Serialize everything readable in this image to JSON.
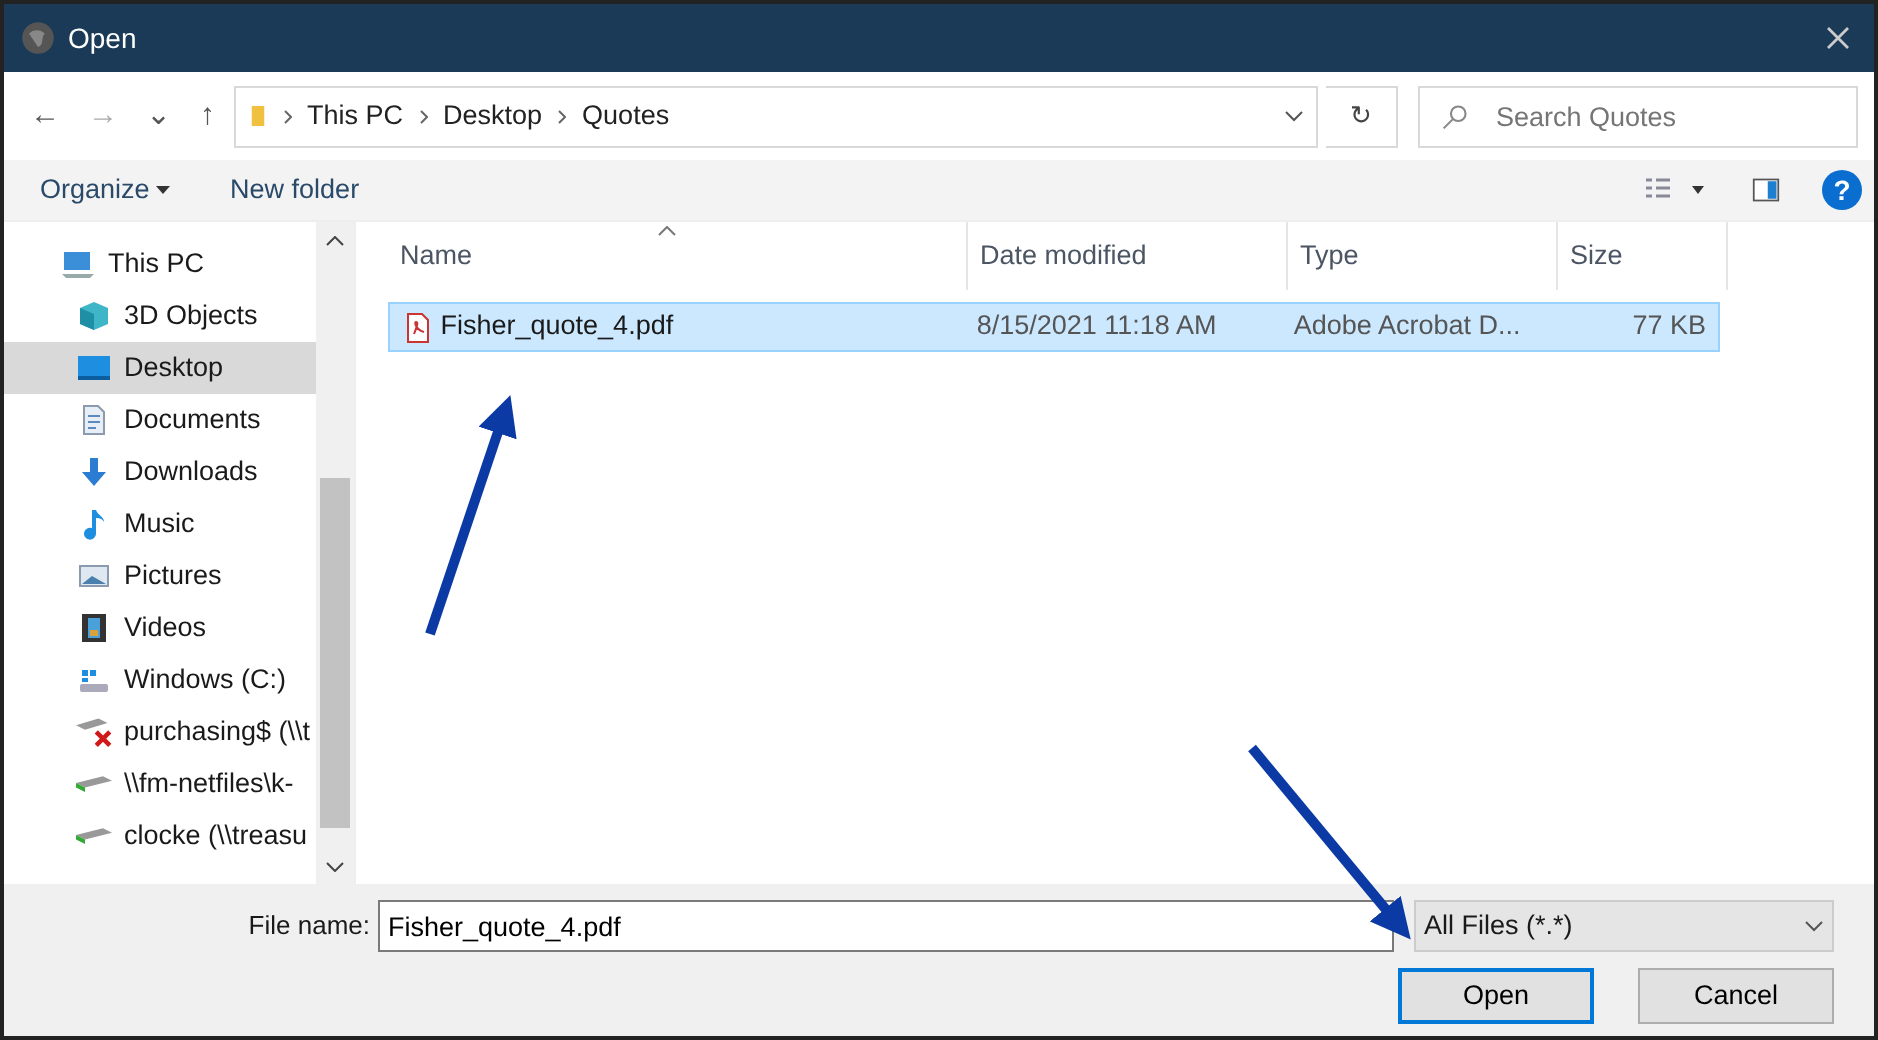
{
  "window": {
    "title": "Open"
  },
  "address": {
    "back": "←",
    "forward": "→",
    "recent": "⌄",
    "up": "↑",
    "path": [
      "This PC",
      "Desktop",
      "Quotes"
    ],
    "refresh": "↻"
  },
  "search": {
    "placeholder": "Search Quotes"
  },
  "toolbar": {
    "organize": "Organize",
    "new_folder": "New folder",
    "help": "?"
  },
  "sidebar": {
    "items": [
      {
        "label": "This PC",
        "kind": "pc",
        "selected": false
      },
      {
        "label": "3D Objects",
        "kind": "cube",
        "selected": false
      },
      {
        "label": "Desktop",
        "kind": "desktop",
        "selected": true
      },
      {
        "label": "Documents",
        "kind": "document",
        "selected": false
      },
      {
        "label": "Downloads",
        "kind": "download",
        "selected": false
      },
      {
        "label": "Music",
        "kind": "music",
        "selected": false
      },
      {
        "label": "Pictures",
        "kind": "pictures",
        "selected": false
      },
      {
        "label": "Videos",
        "kind": "videos",
        "selected": false
      },
      {
        "label": "Windows (C:)",
        "kind": "drive",
        "selected": false
      },
      {
        "label": "purchasing$ (\\\\t",
        "kind": "network_error",
        "selected": false
      },
      {
        "label": "\\\\fm-netfiles\\k-",
        "kind": "network",
        "selected": false
      },
      {
        "label": "clocke (\\\\treasu",
        "kind": "network",
        "selected": false
      }
    ]
  },
  "table": {
    "columns": [
      {
        "label": "Name",
        "sorted": true
      },
      {
        "label": "Date modified",
        "sorted": false
      },
      {
        "label": "Type",
        "sorted": false
      },
      {
        "label": "Size",
        "sorted": false
      }
    ],
    "rows": [
      {
        "name": "Fisher_quote_4.pdf",
        "date": "8/15/2021 11:18 AM",
        "type": "Adobe Acrobat D...",
        "size": "77 KB",
        "selected": true
      }
    ]
  },
  "footer": {
    "file_name_label": "File name:",
    "file_name": "Fisher_quote_4.pdf",
    "filter": "All Files (*.*)",
    "buttons": [
      "Open",
      "Cancel"
    ]
  }
}
